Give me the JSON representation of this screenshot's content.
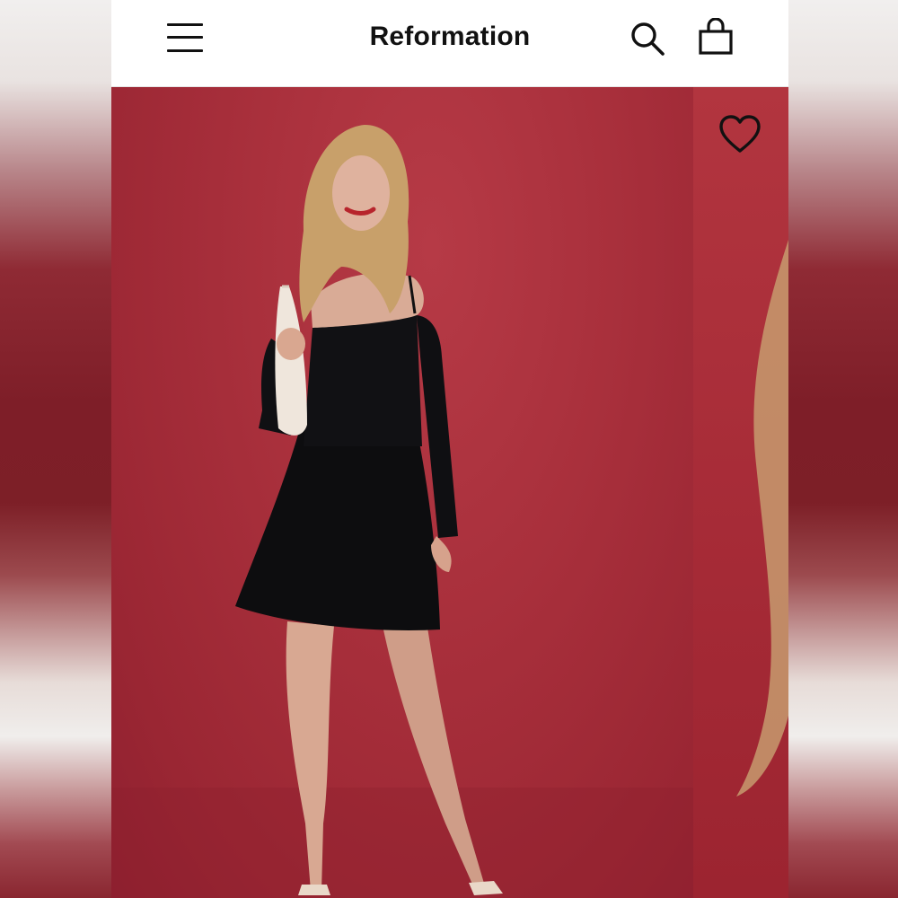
{
  "header": {
    "brand": "Reformation",
    "menu_icon": "hamburger-menu-icon",
    "search_icon": "search-icon",
    "bag_icon": "shopping-bag-icon"
  },
  "product_gallery": {
    "favorite_icon": "heart-outline-icon",
    "background_color": "#a9303c",
    "dress_color": "#0d0d0f"
  }
}
